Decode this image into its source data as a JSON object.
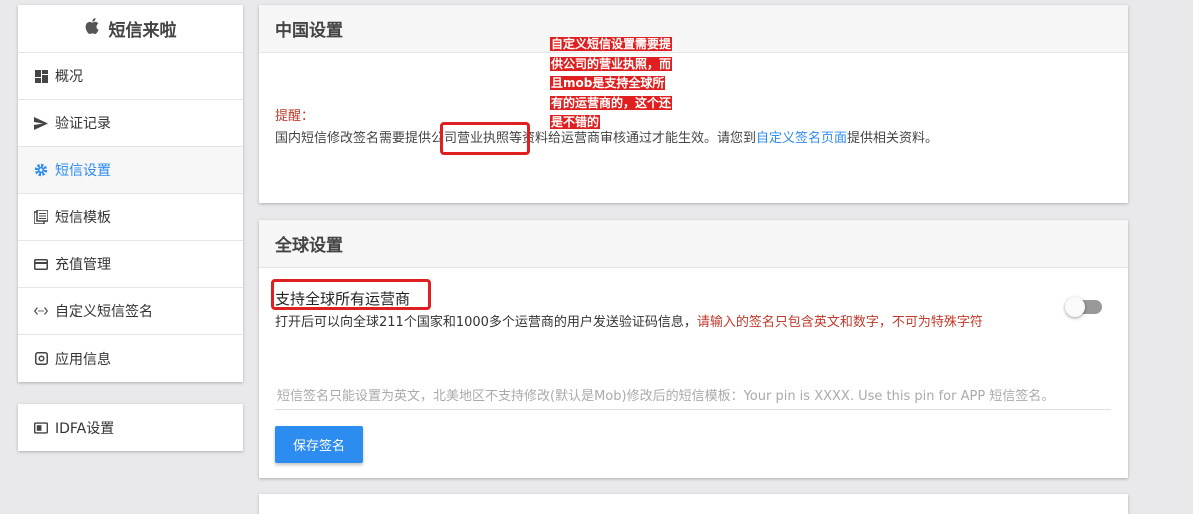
{
  "sidebar": {
    "brand": "短信来啦",
    "items": [
      {
        "label": "概况",
        "icon": "dashboard-icon"
      },
      {
        "label": "验证记录",
        "icon": "send-icon"
      },
      {
        "label": "短信设置",
        "icon": "gear-icon",
        "active": true
      },
      {
        "label": "短信模板",
        "icon": "template-icon"
      },
      {
        "label": "充值管理",
        "icon": "credit-card-icon"
      },
      {
        "label": "自定义短信签名",
        "icon": "code-icon"
      },
      {
        "label": "应用信息",
        "icon": "app-icon"
      }
    ],
    "extra_item": {
      "label": "IDFA设置",
      "icon": "id-card-icon"
    }
  },
  "china": {
    "title": "中国设置",
    "tip_label": "提醒：",
    "tip_prefix": "国内短信修改签名需要提供公司营业执照等资料给运营商审核通过才能生效。请您到",
    "tip_link": "自定义签名页面",
    "tip_suffix": "提供相关资料。"
  },
  "annotation": {
    "lines": [
      "自定义短信设置需要提",
      "供公司的营业执照，而",
      "且mob是支持全球所",
      "有的运营商的，这个还",
      "是不错的"
    ]
  },
  "global": {
    "title": "全球设置",
    "option_title": "支持全球所有运营商",
    "option_desc": "打开后可以向全球211个国家和1000多个运营商的用户发送验证码信息，",
    "option_warn": "请输入的签名只包含英文和数字，不可为特殊字符",
    "toggle_on": false,
    "input_placeholder": "短信签名只能设置为英文，北美地区不支持修改(默认是Mob)修改后的短信模板：Your pin is XXXX. Use this pin for APP 短信签名。",
    "save_label": "保存签名"
  },
  "colors": {
    "accent": "#2d8cf0",
    "annotation_red": "#e02020",
    "warning_text": "#c0392b"
  }
}
